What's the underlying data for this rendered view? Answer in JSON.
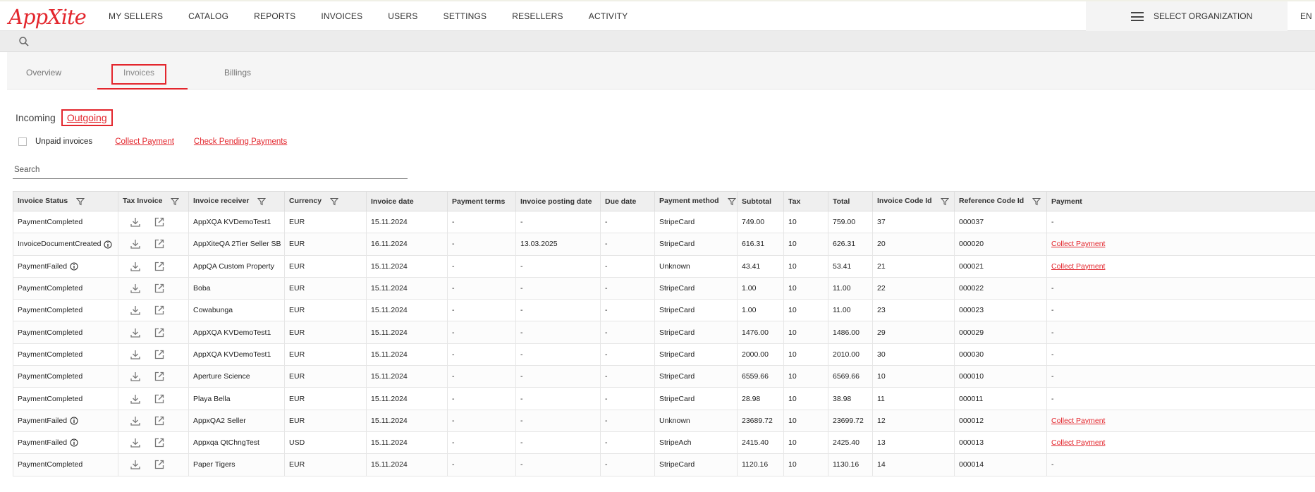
{
  "app": {
    "logo_text": "AppXite",
    "brand_color": "#e3262d"
  },
  "nav": {
    "items": [
      "MY SELLERS",
      "CATALOG",
      "REPORTS",
      "INVOICES",
      "USERS",
      "SETTINGS",
      "RESELLERS",
      "ACTIVITY"
    ],
    "org_select_label": "SELECT ORGANIZATION",
    "language": "EN"
  },
  "tabs": {
    "overview": "Overview",
    "invoices": "Invoices",
    "billings": "Billings",
    "active": "Invoices"
  },
  "subtabs": {
    "incoming": "Incoming",
    "outgoing": "Outgoing",
    "active": "Outgoing"
  },
  "filters": {
    "unpaid_label": "Unpaid invoices",
    "unpaid_checked": false,
    "collect_payment": "Collect Payment",
    "check_pending": "Check Pending Payments"
  },
  "search": {
    "placeholder": "Search",
    "value": ""
  },
  "table": {
    "columns": [
      {
        "label": "Invoice Status",
        "filter": true
      },
      {
        "label": "Tax Invoice",
        "filter": true
      },
      {
        "label": "Invoice receiver",
        "filter": true
      },
      {
        "label": "Currency",
        "filter": true
      },
      {
        "label": "Invoice date",
        "filter": false
      },
      {
        "label": "Payment terms",
        "filter": false
      },
      {
        "label": "Invoice posting date",
        "filter": false
      },
      {
        "label": "Due date",
        "filter": false
      },
      {
        "label": "Payment method",
        "filter": true
      },
      {
        "label": "Subtotal",
        "filter": false
      },
      {
        "label": "Tax",
        "filter": false
      },
      {
        "label": "Total",
        "filter": false
      },
      {
        "label": "Invoice Code Id",
        "filter": true
      },
      {
        "label": "Reference Code Id",
        "filter": true
      },
      {
        "label": "Payment",
        "filter": false
      }
    ],
    "rows": [
      {
        "status": "PaymentCompleted",
        "info": false,
        "receiver": "AppXQA KVDemoTest1",
        "currency": "EUR",
        "invoice_date": "15.11.2024",
        "payment_terms": "-",
        "posting_date": "-",
        "due_date": "-",
        "payment_method": "StripeCard",
        "subtotal": "749.00",
        "tax": "10",
        "total": "759.00",
        "invoice_code": "37",
        "reference_code": "000037",
        "payment": "-",
        "payment_link": false
      },
      {
        "status": "InvoiceDocumentCreated",
        "info": true,
        "receiver": "AppXiteQA 2Tier Seller SB",
        "currency": "EUR",
        "invoice_date": "16.11.2024",
        "payment_terms": "-",
        "posting_date": "13.03.2025",
        "due_date": "-",
        "payment_method": "StripeCard",
        "subtotal": "616.31",
        "tax": "10",
        "total": "626.31",
        "invoice_code": "20",
        "reference_code": "000020",
        "payment": "Collect Payment",
        "payment_link": true
      },
      {
        "status": "PaymentFailed",
        "info": true,
        "receiver": "AppQA Custom Property",
        "currency": "EUR",
        "invoice_date": "15.11.2024",
        "payment_terms": "-",
        "posting_date": "-",
        "due_date": "-",
        "payment_method": "Unknown",
        "subtotal": "43.41",
        "tax": "10",
        "total": "53.41",
        "invoice_code": "21",
        "reference_code": "000021",
        "payment": "Collect Payment",
        "payment_link": true
      },
      {
        "status": "PaymentCompleted",
        "info": false,
        "receiver": "Boba",
        "currency": "EUR",
        "invoice_date": "15.11.2024",
        "payment_terms": "-",
        "posting_date": "-",
        "due_date": "-",
        "payment_method": "StripeCard",
        "subtotal": "1.00",
        "tax": "10",
        "total": "11.00",
        "invoice_code": "22",
        "reference_code": "000022",
        "payment": "-",
        "payment_link": false
      },
      {
        "status": "PaymentCompleted",
        "info": false,
        "receiver": "Cowabunga",
        "currency": "EUR",
        "invoice_date": "15.11.2024",
        "payment_terms": "-",
        "posting_date": "-",
        "due_date": "-",
        "payment_method": "StripeCard",
        "subtotal": "1.00",
        "tax": "10",
        "total": "11.00",
        "invoice_code": "23",
        "reference_code": "000023",
        "payment": "-",
        "payment_link": false
      },
      {
        "status": "PaymentCompleted",
        "info": false,
        "receiver": "AppXQA KVDemoTest1",
        "currency": "EUR",
        "invoice_date": "15.11.2024",
        "payment_terms": "-",
        "posting_date": "-",
        "due_date": "-",
        "payment_method": "StripeCard",
        "subtotal": "1476.00",
        "tax": "10",
        "total": "1486.00",
        "invoice_code": "29",
        "reference_code": "000029",
        "payment": "-",
        "payment_link": false
      },
      {
        "status": "PaymentCompleted",
        "info": false,
        "receiver": "AppXQA KVDemoTest1",
        "currency": "EUR",
        "invoice_date": "15.11.2024",
        "payment_terms": "-",
        "posting_date": "-",
        "due_date": "-",
        "payment_method": "StripeCard",
        "subtotal": "2000.00",
        "tax": "10",
        "total": "2010.00",
        "invoice_code": "30",
        "reference_code": "000030",
        "payment": "-",
        "payment_link": false
      },
      {
        "status": "PaymentCompleted",
        "info": false,
        "receiver": "Aperture Science",
        "currency": "EUR",
        "invoice_date": "15.11.2024",
        "payment_terms": "-",
        "posting_date": "-",
        "due_date": "-",
        "payment_method": "StripeCard",
        "subtotal": "6559.66",
        "tax": "10",
        "total": "6569.66",
        "invoice_code": "10",
        "reference_code": "000010",
        "payment": "-",
        "payment_link": false
      },
      {
        "status": "PaymentCompleted",
        "info": false,
        "receiver": "Playa Bella",
        "currency": "EUR",
        "invoice_date": "15.11.2024",
        "payment_terms": "-",
        "posting_date": "-",
        "due_date": "-",
        "payment_method": "StripeCard",
        "subtotal": "28.98",
        "tax": "10",
        "total": "38.98",
        "invoice_code": "11",
        "reference_code": "000011",
        "payment": "-",
        "payment_link": false
      },
      {
        "status": "PaymentFailed",
        "info": true,
        "receiver": "AppxQA2 Seller",
        "currency": "EUR",
        "invoice_date": "15.11.2024",
        "payment_terms": "-",
        "posting_date": "-",
        "due_date": "-",
        "payment_method": "Unknown",
        "subtotal": "23689.72",
        "tax": "10",
        "total": "23699.72",
        "invoice_code": "12",
        "reference_code": "000012",
        "payment": "Collect Payment",
        "payment_link": true
      },
      {
        "status": "PaymentFailed",
        "info": true,
        "receiver": "Appxqa QtChngTest",
        "currency": "USD",
        "invoice_date": "15.11.2024",
        "payment_terms": "-",
        "posting_date": "-",
        "due_date": "-",
        "payment_method": "StripeAch",
        "subtotal": "2415.40",
        "tax": "10",
        "total": "2425.40",
        "invoice_code": "13",
        "reference_code": "000013",
        "payment": "Collect Payment",
        "payment_link": true
      },
      {
        "status": "PaymentCompleted",
        "info": false,
        "receiver": "Paper Tigers",
        "currency": "EUR",
        "invoice_date": "15.11.2024",
        "payment_terms": "-",
        "posting_date": "-",
        "due_date": "-",
        "payment_method": "StripeCard",
        "subtotal": "1120.16",
        "tax": "10",
        "total": "1130.16",
        "invoice_code": "14",
        "reference_code": "000014",
        "payment": "-",
        "payment_link": false
      }
    ]
  },
  "icons": {
    "search": "search-icon",
    "menu": "hamburger-icon",
    "filter": "filter-icon",
    "info": "info-icon",
    "download": "download-icon",
    "open": "external-link-icon"
  }
}
